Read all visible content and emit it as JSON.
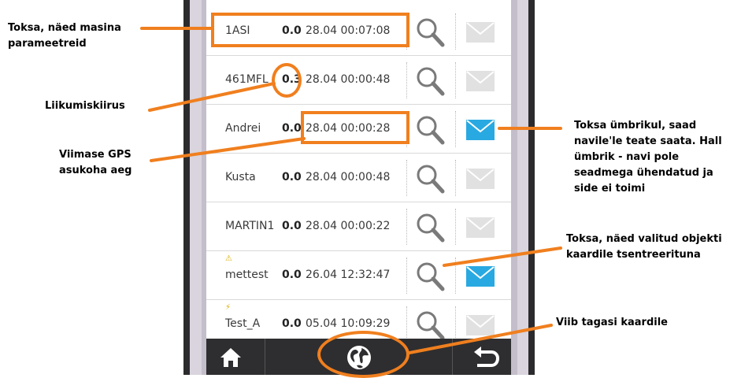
{
  "rows": [
    {
      "name": "1ASI",
      "speed": "0.0",
      "time": "28.04 00:07:08",
      "status": "",
      "mail_active": false
    },
    {
      "name": "461MFL",
      "speed": "0.3",
      "time": "28.04 00:00:48",
      "status": "",
      "mail_active": false
    },
    {
      "name": "Andrei",
      "speed": "0.0",
      "time": "28.04 00:00:28",
      "status": "",
      "mail_active": true
    },
    {
      "name": "Kusta",
      "speed": "0.0",
      "time": "28.04 00:00:48",
      "status": "",
      "mail_active": false
    },
    {
      "name": "MARTIN1",
      "speed": "0.0",
      "time": "28.04 00:00:22",
      "status": "",
      "mail_active": false
    },
    {
      "name": "mettest",
      "speed": "0.0",
      "time": "26.04 12:32:47",
      "status": "warning",
      "mail_active": true
    },
    {
      "name": "Test_A",
      "speed": "0.0",
      "time": "05.04 10:09:29",
      "status": "bolt",
      "mail_active": false
    }
  ],
  "annotations": {
    "params": [
      "Toksa, näed masina",
      "parameetreid"
    ],
    "speed": [
      "Liikumiskiirus"
    ],
    "gps": [
      "Viimase GPS",
      "asukoha aeg"
    ],
    "envelope": [
      "Toksa ümbrikul, saad",
      "navile'le teate saata. Hall",
      "ümbrik - navi pole",
      "seadmega ühendatud ja",
      "side ei toimi"
    ],
    "center": [
      "Toksa, näed valitud objekti",
      "kaardile tsentreerituna"
    ],
    "back": [
      "Viib tagasi kaardile"
    ]
  },
  "colors": {
    "annotation": "#f07f1e",
    "mail_active": "#29a9e1",
    "mail_inactive": "#e1e1e1"
  },
  "bottom_bar": [
    "home-icon",
    "globe-icon",
    "back-arrow-icon"
  ]
}
